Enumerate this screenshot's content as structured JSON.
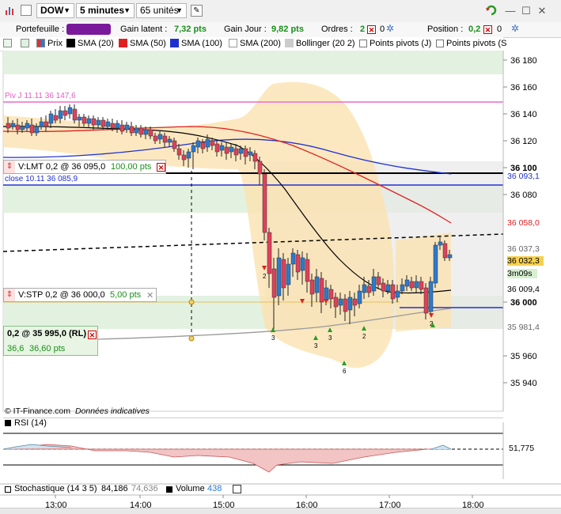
{
  "toolbar": {
    "symbol": "DOW",
    "period": "5 minutes",
    "units": "65 unités",
    "edit_icon": "edit-icon",
    "colors": {
      "bg": "#f0f0f0"
    }
  },
  "inforow": {
    "portefeuille_label": "Portefeuille :",
    "gain_latent_label": "Gain latent :",
    "gain_latent_value": "7,32 pts",
    "gain_jour_label": "Gain Jour :",
    "gain_jour_value": "9,82 pts",
    "ordres_label": "Ordres :",
    "ordres_value1": "2",
    "ordres_value2": "0",
    "position_label": "Position :",
    "position_value1": "0,2",
    "position_value2": "0"
  },
  "legend": {
    "prix": "Prix",
    "sma20": "SMA (20)",
    "sma50": "SMA (50)",
    "sma100": "SMA (100)",
    "sma200": "SMA (200)",
    "bollinger": "Bollinger (20 2)",
    "pivots_j": "Points pivots (J)",
    "pivots_s": "Points pivots (S"
  },
  "chart": {
    "piv_label": "Piv J 11.11 36 147,6",
    "close_label": "close 10.11 36 085,9",
    "lmt_order": {
      "label": "V:LMT  0,2 @ 36 095,0",
      "distance": "100,00 pts"
    },
    "stp_order": {
      "label": "V:STP  0,2 @ 36 000,0",
      "distance": "5,00 pts"
    },
    "position_box": {
      "label": "0,2 @ 35 995,0 (RL)",
      "qty": "36,6",
      "pts": "36,60 pts"
    },
    "price_ticks": [
      "36 180",
      "36 160",
      "36 140",
      "36 120",
      "36 100",
      "36 080",
      "36 000",
      "35 960",
      "35 940"
    ],
    "price_tags": {
      "p36093": "36 093,1",
      "p36058": "36 058,0",
      "p36037": "36 037,3",
      "p36032": "36 032,3",
      "timer": "3m09s",
      "p36009": "36 009,4",
      "p35981": "35 981,4"
    },
    "signal_numbers": [
      "2",
      "3",
      "3",
      "3",
      "2",
      "6",
      "2",
      "2"
    ],
    "footer_source": "© IT-Finance.com",
    "footer_note": "Données indicatives",
    "colors": {
      "up": "#2a7ad0",
      "down": "#e0405a",
      "boll": "#fbe6b8",
      "piv": "#e86bd0",
      "sma50": "#e02020",
      "sma100": "#2030d0"
    }
  },
  "rsi": {
    "label": "RSI (14)",
    "value": "51,775"
  },
  "stoch": {
    "label": "Stochastique (14 3 5)",
    "v1": "84,186",
    "v2": "74,636"
  },
  "volume": {
    "label": "Volume",
    "value": "438"
  },
  "time_axis": {
    "labels": [
      "13:00",
      "14:00",
      "15:00",
      "16:00",
      "17:00",
      "18:00"
    ]
  }
}
